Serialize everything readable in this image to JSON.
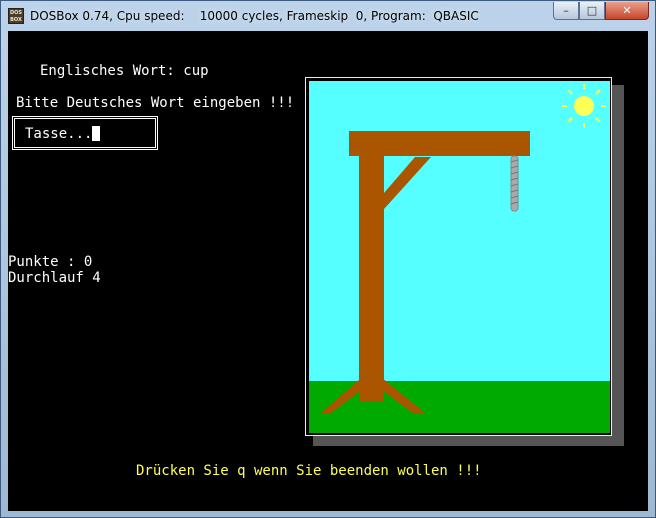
{
  "window": {
    "icon_text": "DOS BOX",
    "title": "DOSBox 0.74, Cpu speed:    10000 cycles, Frameskip  0, Program:  QBASIC",
    "minimize_glyph": "–",
    "maximize_glyph": "□",
    "close_glyph": "✕"
  },
  "game": {
    "english_word_line": "Englisches Wort: cup",
    "prompt": "Bitte Deutsches Wort eingeben !!!",
    "input_value": "Tasse...",
    "score_line": "Punkte : 0",
    "round_line": "Durchlauf 4",
    "quit_hint": "Drücken Sie q wenn Sie beenden wollen !!!"
  },
  "colors": {
    "sky": "#55ffff",
    "grass": "#00aa00",
    "wood": "#aa5500",
    "sun": "#ffff55",
    "rope": "#aaaaaa",
    "frame": "#ffff55",
    "hint_text": "#ffff55"
  },
  "icons": {
    "app": "dosbox-icon",
    "sun": "sun-icon",
    "rope": "noose-rope"
  }
}
